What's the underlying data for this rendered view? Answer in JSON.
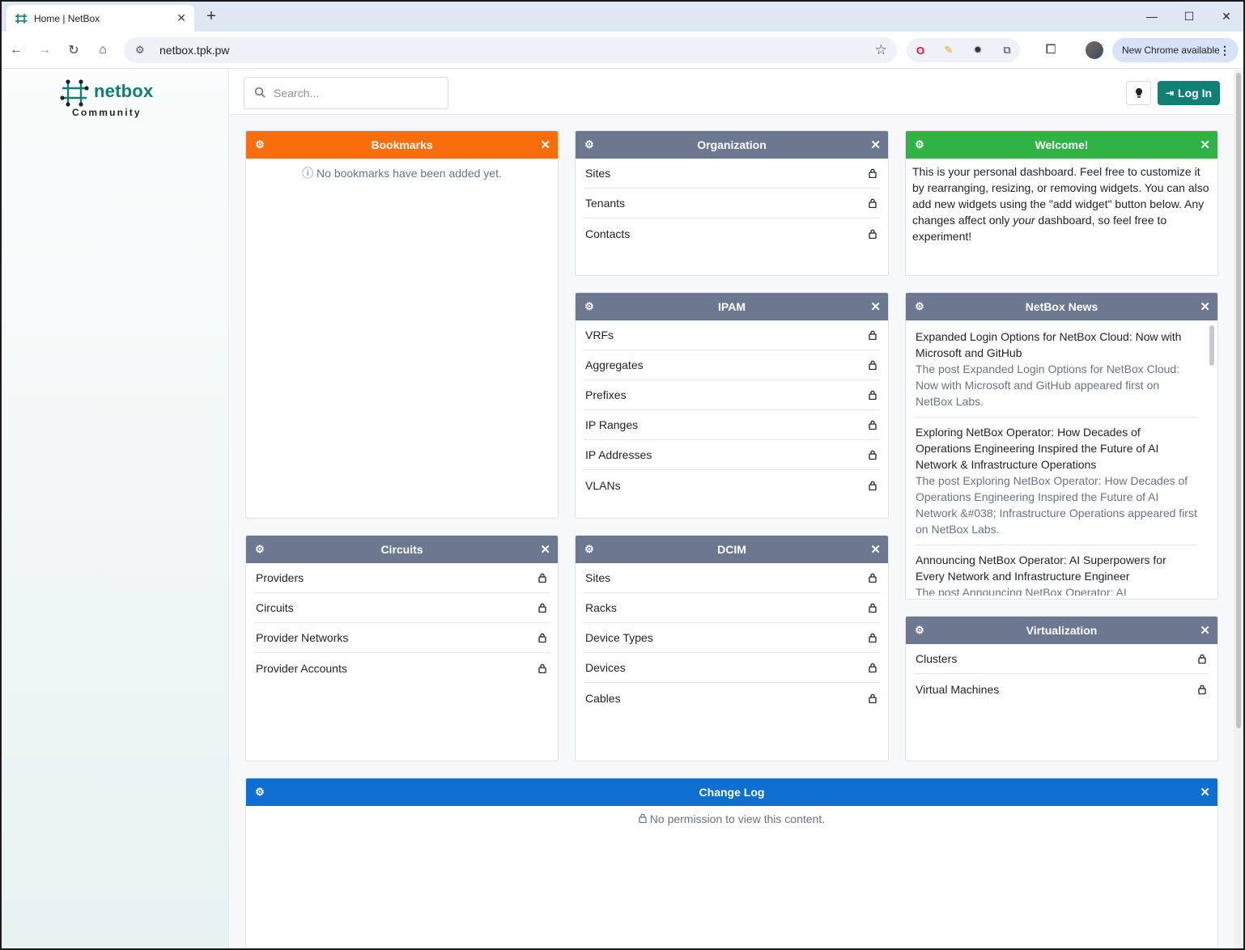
{
  "browser": {
    "tab_title": "Home | NetBox",
    "url": "netbox.tpk.pw",
    "new_chrome": "New Chrome available"
  },
  "brand": {
    "name": "netbox",
    "edition": "Community",
    "color": "#117f74"
  },
  "topbar": {
    "search_placeholder": "Search...",
    "login_label": "Log In"
  },
  "widgets": {
    "bookmarks": {
      "title": "Bookmarks",
      "empty": "No bookmarks have been added yet.",
      "color": "#f96d0a"
    },
    "organization": {
      "title": "Organization",
      "items": [
        "Sites",
        "Tenants",
        "Contacts"
      ]
    },
    "welcome": {
      "title": "Welcome!",
      "text_a": "This is your personal dashboard. Feel free to customize it by rearranging, resizing, or removing widgets. You can also add new widgets using the \"add widget\" button below. Any changes affect only ",
      "text_em": "your",
      "text_b": " dashboard, so feel free to experiment!",
      "color": "#2fb344"
    },
    "ipam": {
      "title": "IPAM",
      "items": [
        "VRFs",
        "Aggregates",
        "Prefixes",
        "IP Ranges",
        "IP Addresses",
        "VLANs"
      ]
    },
    "news": {
      "title": "NetBox News",
      "items": [
        {
          "title": "Expanded Login Options for NetBox Cloud: Now with Microsoft and GitHub",
          "desc": "The post Expanded Login Options for NetBox Cloud: Now with Microsoft and GitHub appeared first on NetBox Labs."
        },
        {
          "title": "Exploring NetBox Operator: How Decades of Operations Engineering Inspired the Future of AI Network & Infrastructure Operations",
          "desc": "The post Exploring NetBox Operator: How Decades of Operations Engineering Inspired the Future of AI Network &#038; Infrastructure Operations appeared first on NetBox Labs."
        },
        {
          "title": "Announcing NetBox Operator: AI Superpowers for Every Network and Infrastructure Engineer",
          "desc": "The post Announcing NetBox Operator: AI"
        }
      ]
    },
    "circuits": {
      "title": "Circuits",
      "items": [
        "Providers",
        "Circuits",
        "Provider Networks",
        "Provider Accounts"
      ]
    },
    "dcim": {
      "title": "DCIM",
      "items": [
        "Sites",
        "Racks",
        "Device Types",
        "Devices",
        "Cables"
      ]
    },
    "virtualization": {
      "title": "Virtualization",
      "items": [
        "Clusters",
        "Virtual Machines"
      ]
    },
    "changelog": {
      "title": "Change Log",
      "empty": "No permission to view this content.",
      "color": "#0d6fd1"
    }
  }
}
